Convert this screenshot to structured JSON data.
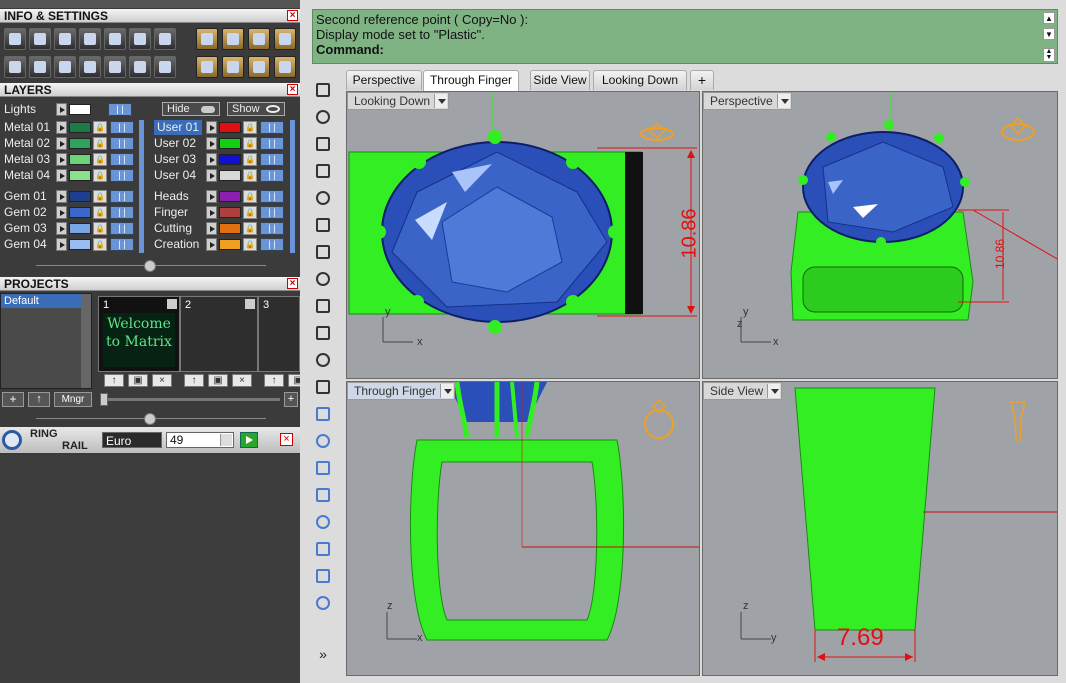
{
  "panels": {
    "info_settings": "INFO & SETTINGS",
    "layers": "LAYERS",
    "projects": "PROJECTS"
  },
  "layers": {
    "lights_label": "Lights",
    "hide_label": "Hide",
    "show_label": "Show",
    "left": [
      {
        "name": "Metal 01",
        "color": "#1f7a4a"
      },
      {
        "name": "Metal 02",
        "color": "#2ea35e"
      },
      {
        "name": "Metal 03",
        "color": "#6fd07a"
      },
      {
        "name": "Metal 04",
        "color": "#8ce08c"
      },
      {
        "name": "Gem 01",
        "color": "#1d3f8f"
      },
      {
        "name": "Gem 02",
        "color": "#3a68c8"
      },
      {
        "name": "Gem 03",
        "color": "#7aa6e8"
      },
      {
        "name": "Gem 04",
        "color": "#9bbcf0"
      }
    ],
    "right": [
      {
        "name": "User 01",
        "color": "#e01010"
      },
      {
        "name": "User 02",
        "color": "#10d010"
      },
      {
        "name": "User 03",
        "color": "#1010d0"
      },
      {
        "name": "User 04",
        "color": "#d8d8d8"
      },
      {
        "name": "Heads",
        "color": "#8a1fb0"
      },
      {
        "name": "Finger",
        "color": "#b04040"
      },
      {
        "name": "Cutting",
        "color": "#e07010"
      },
      {
        "name": "Creation",
        "color": "#f0a020"
      }
    ]
  },
  "projects": {
    "list": [
      "Default"
    ],
    "slots": [
      "1",
      "2",
      "3"
    ],
    "welcome_text": "Welcome to Matrix",
    "mngr_label": "Mngr"
  },
  "ring_rail": {
    "label_line1": "RING",
    "label_line2": "RAIL",
    "size_system": "Euro",
    "size_value": "49"
  },
  "command": {
    "line1": "Second reference point ( Copy=No ):",
    "line2": "Display mode set to \"Plastic\".",
    "prompt": "Command:"
  },
  "tabs": [
    "Perspective",
    "Through Finger",
    "Side View",
    "Looking Down"
  ],
  "active_tab": "Through Finger",
  "add_tab_symbol": "+",
  "viewports": [
    {
      "label": "Looking Down",
      "dimension": "10.86",
      "axes": [
        "y",
        "x"
      ]
    },
    {
      "label": "Perspective",
      "dimension": "10.86",
      "axes": [
        "z",
        "y",
        "x"
      ]
    },
    {
      "label": "Through Finger",
      "axes": [
        "z",
        "x"
      ]
    },
    {
      "label": "Side View",
      "dimension": "7.69",
      "axes": [
        "z",
        "y"
      ]
    }
  ],
  "toolbar_more": "»",
  "colors": {
    "model_green": "#33ee22",
    "gem_blue": "#2a4fb8",
    "dimension_red": "#e01010",
    "command_bg": "#7fb384",
    "viewport_bg": "#9fa3a8"
  }
}
